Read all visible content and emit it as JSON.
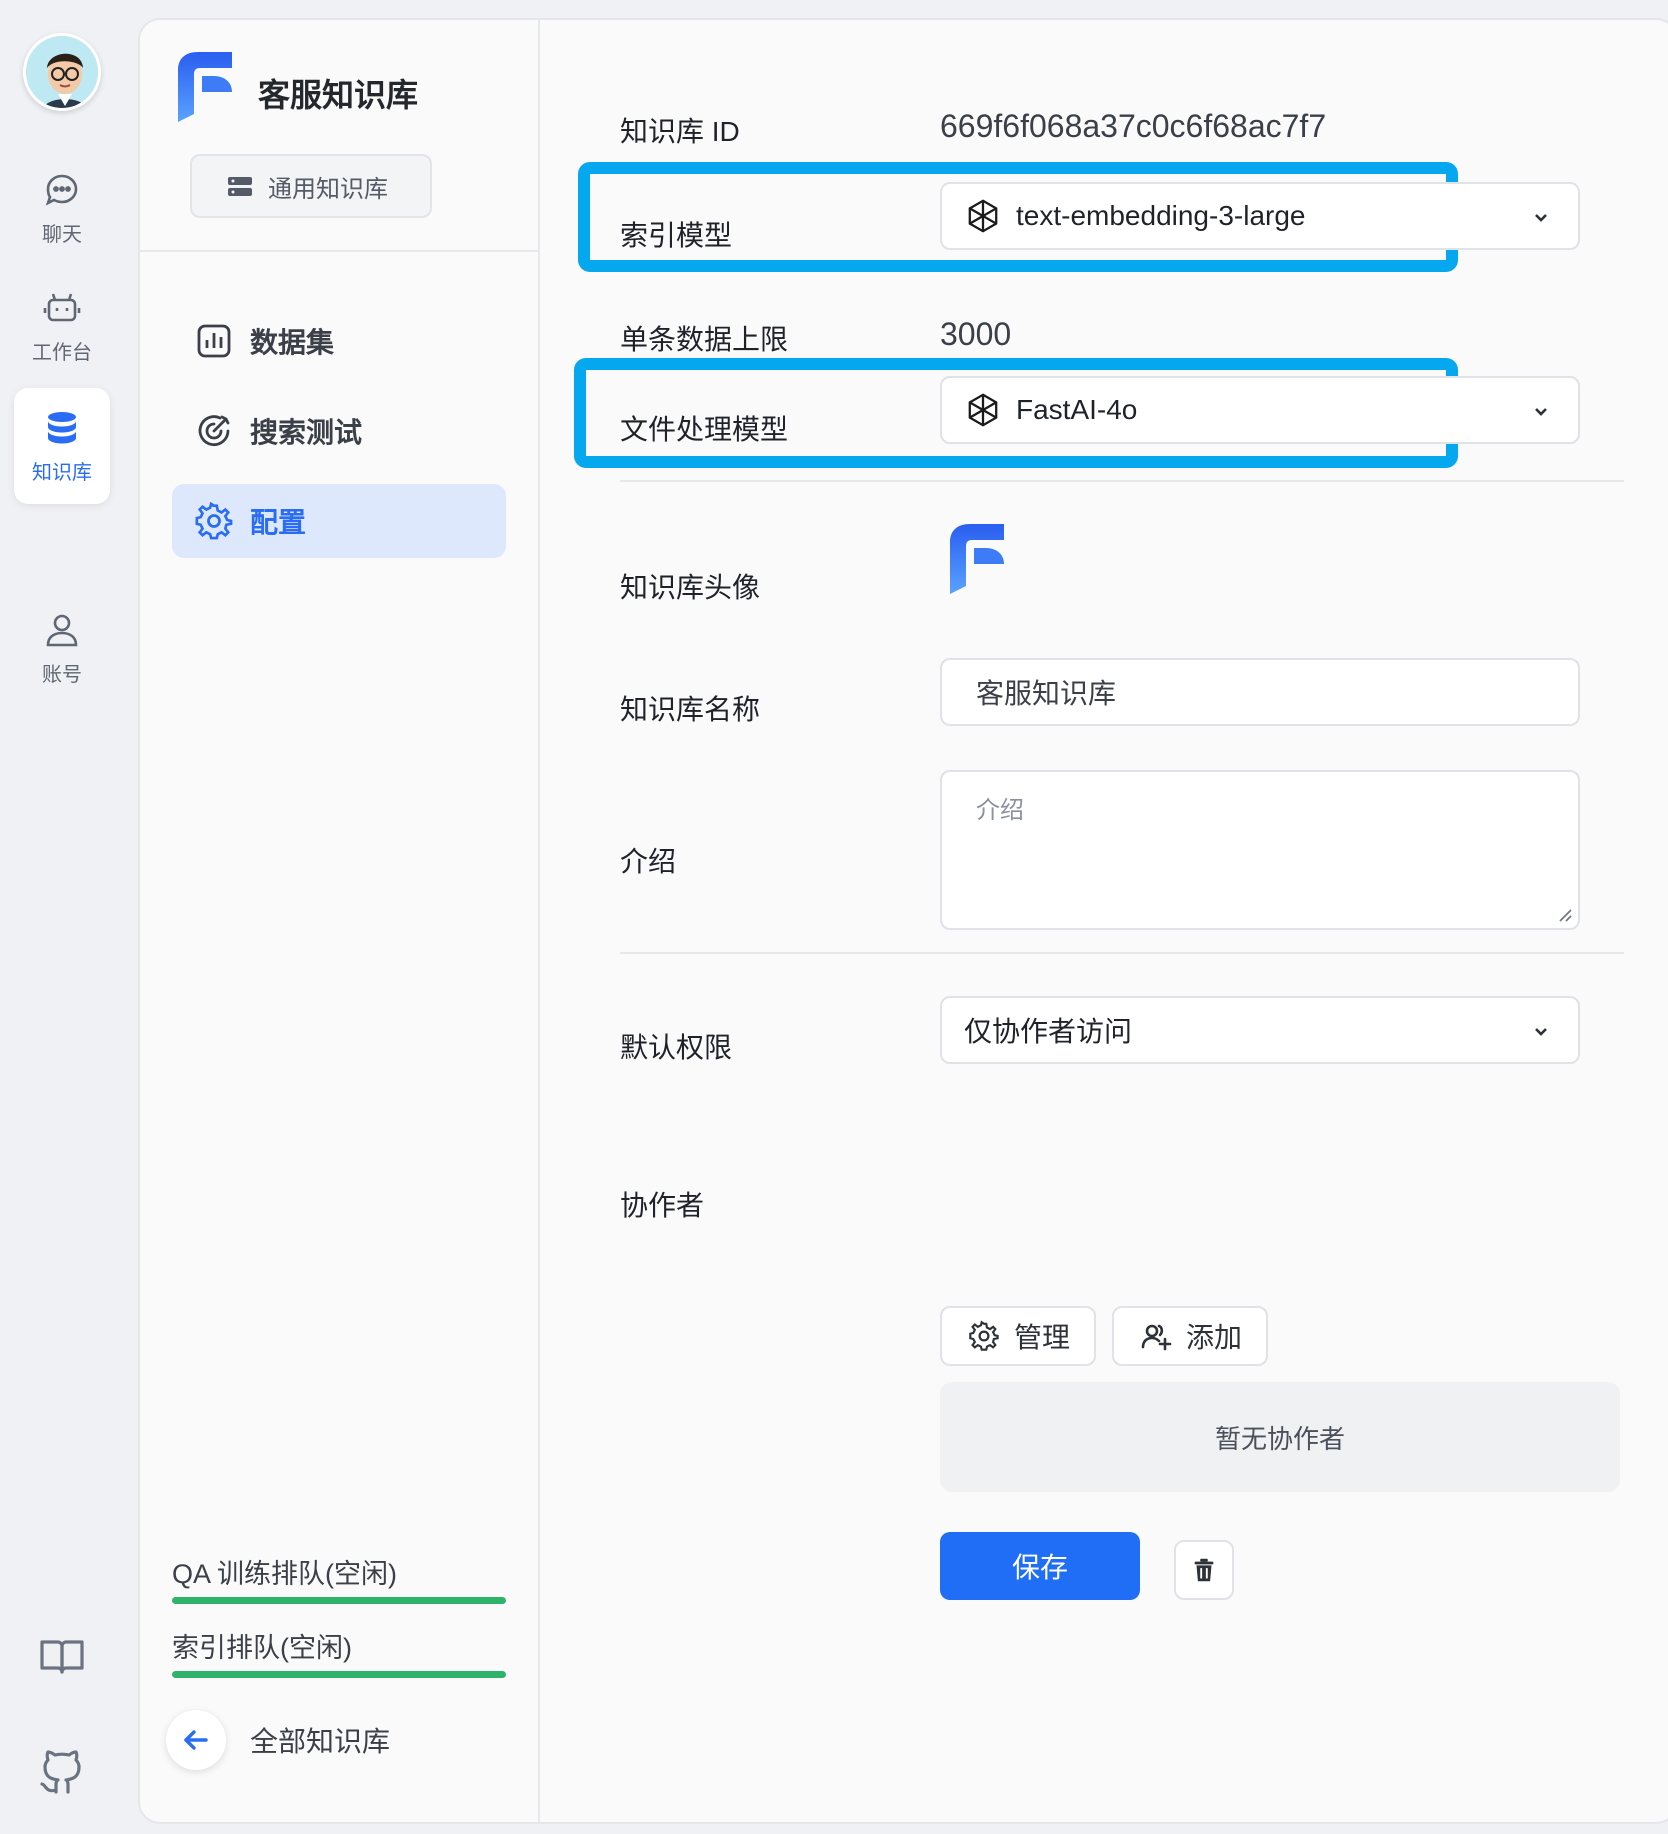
{
  "rail": {
    "items": [
      {
        "label": "聊天",
        "icon": "chat-icon"
      },
      {
        "label": "工作台",
        "icon": "robot-icon"
      },
      {
        "label": "知识库",
        "icon": "database-icon",
        "active": true
      },
      {
        "label": "账号",
        "icon": "user-icon"
      }
    ],
    "bottom_icons": [
      "book-icon",
      "github-icon"
    ]
  },
  "sidebar": {
    "kb_title": "客服知识库",
    "kb_type": "通用知识库",
    "nav": [
      {
        "label": "数据集",
        "icon": "chart-icon"
      },
      {
        "label": "搜索测试",
        "icon": "target-icon"
      },
      {
        "label": "配置",
        "icon": "gear-icon",
        "active": true
      }
    ],
    "queues": [
      {
        "label": "QA 训练排队(空闲)",
        "progress": 1.0
      },
      {
        "label": "索引排队(空闲)",
        "progress": 1.0
      }
    ],
    "back_label": "全部知识库"
  },
  "form": {
    "kb_id_label": "知识库 ID",
    "kb_id_value": "669f6f068a37c0c6f68ac7f7",
    "index_model_label": "索引模型",
    "index_model_value": "text-embedding-3-large",
    "max_data_label": "单条数据上限",
    "max_data_value": "3000",
    "file_model_label": "文件处理模型",
    "file_model_value": "FastAI-4o",
    "avatar_label": "知识库头像",
    "name_label": "知识库名称",
    "name_value": "客服知识库",
    "intro_label": "介绍",
    "intro_placeholder": "介绍",
    "permission_label": "默认权限",
    "permission_value": "仅协作者访问",
    "collab_label": "协作者",
    "manage_label": "管理",
    "add_label": "添加",
    "no_collab": "暂无协作者",
    "save_label": "保存"
  },
  "colors": {
    "accent": "#1f6ef5",
    "highlight": "#05a7ef",
    "queue_bar": "#2fb36a",
    "active_nav_bg": "#dde8fd"
  }
}
